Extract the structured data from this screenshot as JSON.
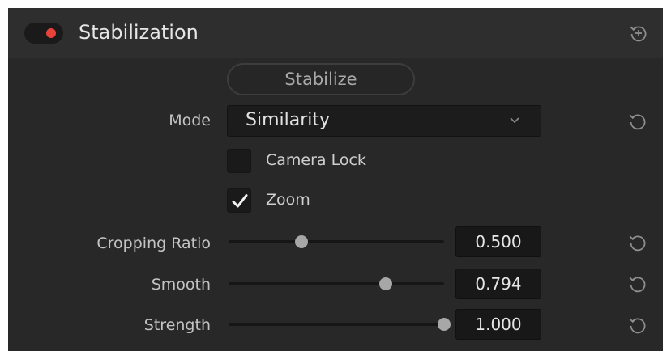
{
  "header": {
    "title": "Stabilization",
    "enabled": true,
    "toggle_color": "#e8433a",
    "reset_all_icon": "reset-add-icon"
  },
  "stabilize_button": {
    "label": "Stabilize"
  },
  "mode": {
    "label": "Mode",
    "value": "Similarity",
    "icon": "chevron-down-icon"
  },
  "camera_lock": {
    "label": "Camera Lock",
    "checked": false
  },
  "zoom": {
    "label": "Zoom",
    "checked": true
  },
  "sliders": [
    {
      "label": "Cropping Ratio",
      "value": "0.500",
      "fraction": 0.34
    },
    {
      "label": "Smooth",
      "value": "0.794",
      "fraction": 0.73
    },
    {
      "label": "Strength",
      "value": "1.000",
      "fraction": 1.0
    }
  ],
  "reset_icon": "reset-icon"
}
